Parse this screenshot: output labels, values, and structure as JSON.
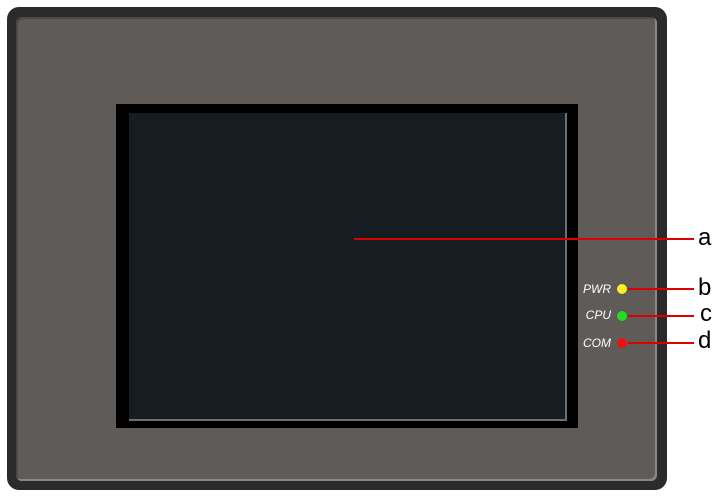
{
  "indicators": [
    {
      "label": "PWR",
      "color": "#ffee22"
    },
    {
      "label": "CPU",
      "color": "#22dd22"
    },
    {
      "label": "COM",
      "color": "#ee1111"
    }
  ],
  "callouts": [
    "a",
    "b",
    "c",
    "d"
  ],
  "colors": {
    "leader_line": "#dd0000",
    "bezel": "#5e5b59",
    "screen": "#161d22"
  }
}
